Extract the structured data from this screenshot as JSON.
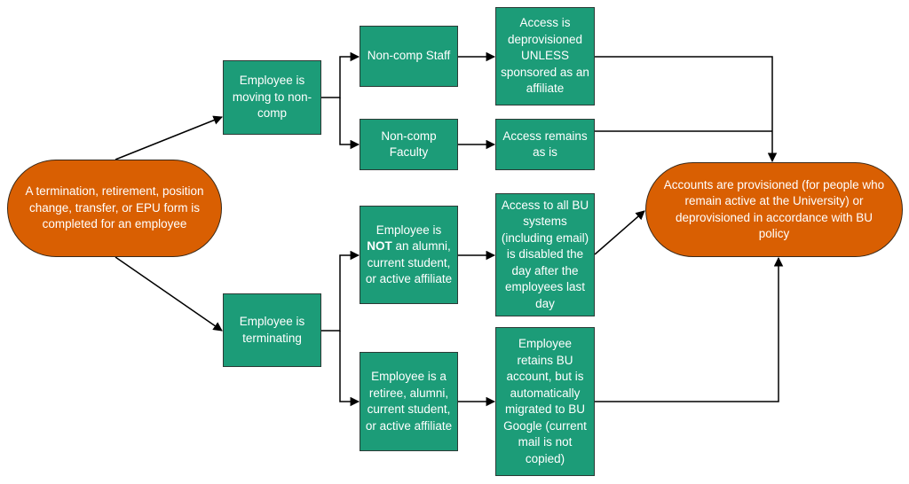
{
  "diagram": {
    "type": "flowchart",
    "colors": {
      "process_box": "#1c9c78",
      "terminal_pill": "#d95f02",
      "text": "#ffffff",
      "connector": "#000000"
    },
    "nodes": {
      "start": {
        "text": "A termination, retirement, position change, transfer, or EPU form is completed for an employee",
        "shape": "pill"
      },
      "moving": {
        "text": "Employee is moving to non-comp",
        "shape": "rect"
      },
      "terminating": {
        "text": "Employee is terminating",
        "shape": "rect"
      },
      "noncomp_staff": {
        "text": "Non-comp Staff",
        "shape": "rect"
      },
      "noncomp_faculty": {
        "text": "Non-comp Faculty",
        "shape": "rect"
      },
      "not_affiliate": {
        "bold": "NOT",
        "prefix": "Employee is ",
        "suffix": " an alumni, current student, or active affiliate",
        "shape": "rect"
      },
      "is_affiliate": {
        "text": "Employee is a retiree, alumni, current student, or active affiliate",
        "shape": "rect"
      },
      "deprovisioned": {
        "text": "Access is deprovisioned UNLESS sponsored as an affiliate",
        "shape": "rect"
      },
      "remains": {
        "text": "Access remains as is",
        "shape": "rect"
      },
      "disabled": {
        "text": "Access to all BU systems (including email) is disabled the day after the employees last day",
        "shape": "rect"
      },
      "retains": {
        "text": "Employee retains BU account, but is automatically migrated to BU Google (current mail is not copied)",
        "shape": "rect"
      },
      "end": {
        "text": "Accounts are provisioned (for people who remain active at the University) or deprovisioned in accordance with BU policy",
        "shape": "pill"
      }
    },
    "edges": [
      {
        "from": "start",
        "to": "moving"
      },
      {
        "from": "start",
        "to": "terminating"
      },
      {
        "from": "moving",
        "to": "noncomp_staff"
      },
      {
        "from": "moving",
        "to": "noncomp_faculty"
      },
      {
        "from": "noncomp_staff",
        "to": "deprovisioned"
      },
      {
        "from": "noncomp_faculty",
        "to": "remains"
      },
      {
        "from": "terminating",
        "to": "not_affiliate"
      },
      {
        "from": "terminating",
        "to": "is_affiliate"
      },
      {
        "from": "not_affiliate",
        "to": "disabled"
      },
      {
        "from": "is_affiliate",
        "to": "retains"
      },
      {
        "from": "deprovisioned",
        "to": "end"
      },
      {
        "from": "remains",
        "to": "end"
      },
      {
        "from": "disabled",
        "to": "end"
      },
      {
        "from": "retains",
        "to": "end"
      }
    ]
  }
}
